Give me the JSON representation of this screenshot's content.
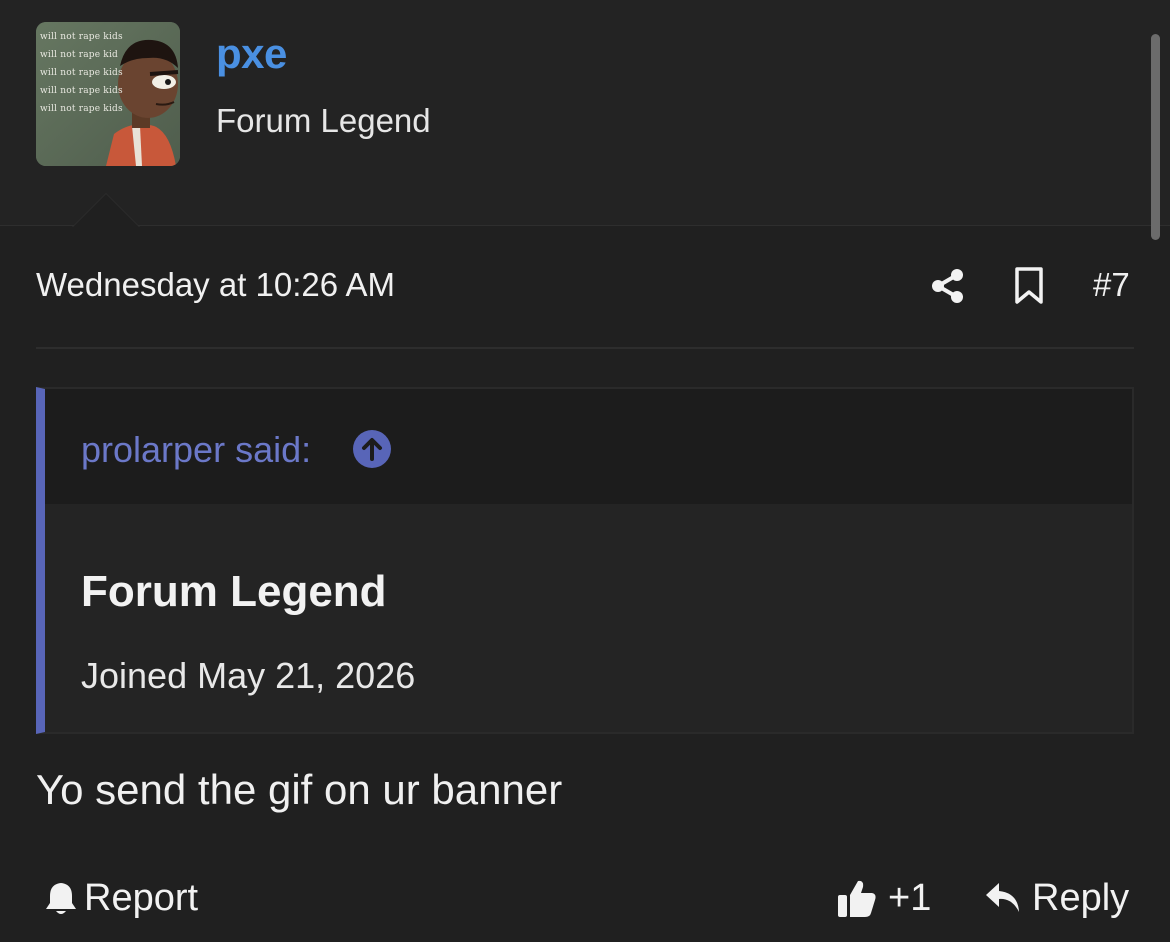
{
  "user": {
    "avatar_board_text": "will not rape kids\nwill not rape kid\nwill not rape kids\nwill not rape kids\nwill not rape kids",
    "name": "pxe",
    "title": "Forum Legend"
  },
  "post": {
    "date": "Wednesday at 10:26 AM",
    "number": "#7",
    "body": "Yo send the gif on ur banner"
  },
  "quote": {
    "author_label": "prolarper said:",
    "heading": "Forum Legend",
    "joined": "Joined May 21, 2026"
  },
  "actions": {
    "report_label": "Report",
    "like_count": "+1",
    "reply_label": "Reply"
  },
  "icons": {
    "share": "share-icon",
    "bookmark": "bookmark-icon",
    "quote_jump": "arrow-up-circle-icon",
    "report": "bell-icon",
    "like": "thumbs-up-icon",
    "reply": "reply-arrow-icon"
  },
  "colors": {
    "background": "#202020",
    "username": "#4a90e2",
    "quote_accent": "#5865b8",
    "quote_author": "#6b78c8"
  }
}
